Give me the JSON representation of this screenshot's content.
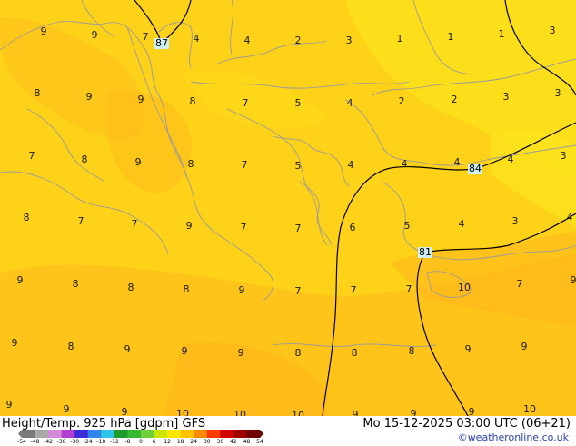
{
  "footer": {
    "title": "Height/Temp. 925 hPa [gdpm] GFS",
    "datetime": "Mo 15-12-2025 03:00 UTC (06+21)",
    "credit": "©weatheronline.co.uk"
  },
  "legend": {
    "ticks": [
      "-54",
      "-48",
      "-42",
      "-38",
      "-30",
      "-24",
      "-18",
      "-12",
      "-8",
      "0",
      "6",
      "12",
      "18",
      "24",
      "30",
      "36",
      "42",
      "48",
      "54"
    ],
    "colors": [
      "#7a7a7a",
      "#a8a8a8",
      "#d28ad8",
      "#b33fd0",
      "#3a2cd8",
      "#2f86ea",
      "#2cc6e8",
      "#1e9a2c",
      "#37b832",
      "#6fd03a",
      "#c8e600",
      "#ffe800",
      "#ffc200",
      "#ff8a00",
      "#ff3a00",
      "#d40000",
      "#a00000",
      "#6e0000"
    ]
  },
  "isolines": [
    {
      "label": "87"
    },
    {
      "label": "84"
    },
    {
      "label": "81"
    }
  ],
  "temperatures": [
    "9",
    "9",
    "7",
    "4",
    "4",
    "2",
    "3",
    "1",
    "1",
    "1",
    "3",
    "8",
    "9",
    "9",
    "8",
    "7",
    "5",
    "4",
    "2",
    "2",
    "3",
    "3",
    "7",
    "8",
    "9",
    "8",
    "7",
    "5",
    "4",
    "4",
    "4",
    "4",
    "3",
    "8",
    "7",
    "7",
    "9",
    "7",
    "7",
    "6",
    "5",
    "4",
    "3",
    "4",
    "9",
    "8",
    "8",
    "8",
    "9",
    "7",
    "7",
    "7",
    "10",
    "7",
    "9",
    "9",
    "8",
    "9",
    "9",
    "9",
    "8",
    "8",
    "8",
    "9",
    "9",
    "9",
    "9",
    "9",
    "10",
    "10",
    "10",
    "9",
    "9",
    "9",
    "10"
  ],
  "colors": {
    "base": "#ffd21a",
    "warm_patch": "#ffc21a",
    "cool_patch": "#fbe21c",
    "coast": "#9a9a9a",
    "isoline": "#000000"
  }
}
